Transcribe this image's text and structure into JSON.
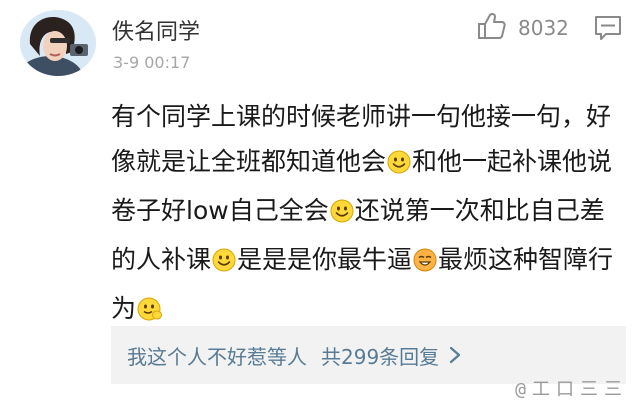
{
  "comment": {
    "username": "佚名同学",
    "timestamp": "3-9 00:17",
    "like_count": "8032",
    "body_segments": [
      {
        "text": "有个同学上课的时候老师讲一句他接一句，好像就是让全班都知道他会"
      },
      {
        "emoji": "smile"
      },
      {
        "text": "和他一起补课他说卷子好low自己全会"
      },
      {
        "emoji": "smile"
      },
      {
        "text": "还说第一次和比自己差的人补课"
      },
      {
        "emoji": "smile"
      },
      {
        "text": "是是是你最牛逼"
      },
      {
        "emoji": "grin"
      },
      {
        "text": "最烦这种智障行为"
      },
      {
        "emoji": "smile-hand"
      }
    ]
  },
  "reply": {
    "preview_text": "我这个人不好惹等人",
    "count_text": "共299条回复"
  },
  "watermark": "@工口三三",
  "colors": {
    "link": "#587b95",
    "emoji_yellow": "#ffd83a",
    "emoji_outline": "#d9a400"
  }
}
